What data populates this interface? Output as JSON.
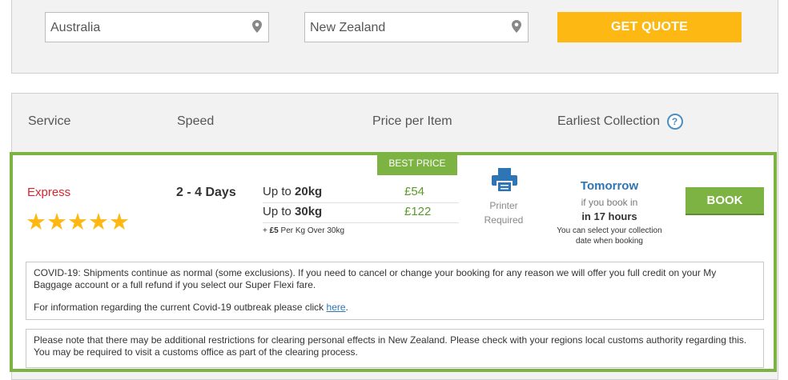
{
  "quote_form": {
    "from_value": "Australia",
    "to_value": "New Zealand",
    "quote_button": "GET QUOTE"
  },
  "columns": {
    "service": "Service",
    "speed": "Speed",
    "price": "Price per Item",
    "collection": "Earliest Collection",
    "help_glyph": "?"
  },
  "result": {
    "badge": "BEST PRICE",
    "service_name": "Express",
    "stars": "★★★★★",
    "rating": 5,
    "speed": "2 - 4 Days",
    "prices": [
      {
        "prefix": "Up to ",
        "weight": "20kg",
        "price": "£54"
      },
      {
        "prefix": "Up to ",
        "weight": "30kg",
        "price": "£122"
      }
    ],
    "extra_prefix": "+ ",
    "extra_amount": "£5",
    "extra_suffix": " Per Kg Over 30kg",
    "printer_label_1": "Printer",
    "printer_label_2": "Required",
    "collection_title": "Tomorrow",
    "collection_line1": "if you book in",
    "collection_line2": "in 17 hours",
    "collection_note_1": "You can select your collection",
    "collection_note_2": "date when booking",
    "book_button": "BOOK"
  },
  "notices": {
    "covid_text": "COVID-19: Shipments continue as normal (some exclusions). If you need to cancel or change your booking for any reason we will offer you full credit on your My Baggage account or a full refund if you select our Super Flexi fare.",
    "covid_info": "For information regarding the current Covid-19 outbreak please click ",
    "covid_link": "here",
    "covid_info_end": ".",
    "customs_text": "Please note that there may be additional restrictions for clearing personal effects in New Zealand. Please check with your regions local customs authority regarding this. You may be required to visit a customs office as part of the clearing process."
  },
  "colors": {
    "accent_yellow": "#fdb813",
    "accent_green": "#7cb342",
    "service_red": "#d9242f",
    "link_blue": "#2e75b6"
  },
  "icons": [
    "location-pin-icon",
    "help-icon",
    "star-icon",
    "printer-icon"
  ]
}
